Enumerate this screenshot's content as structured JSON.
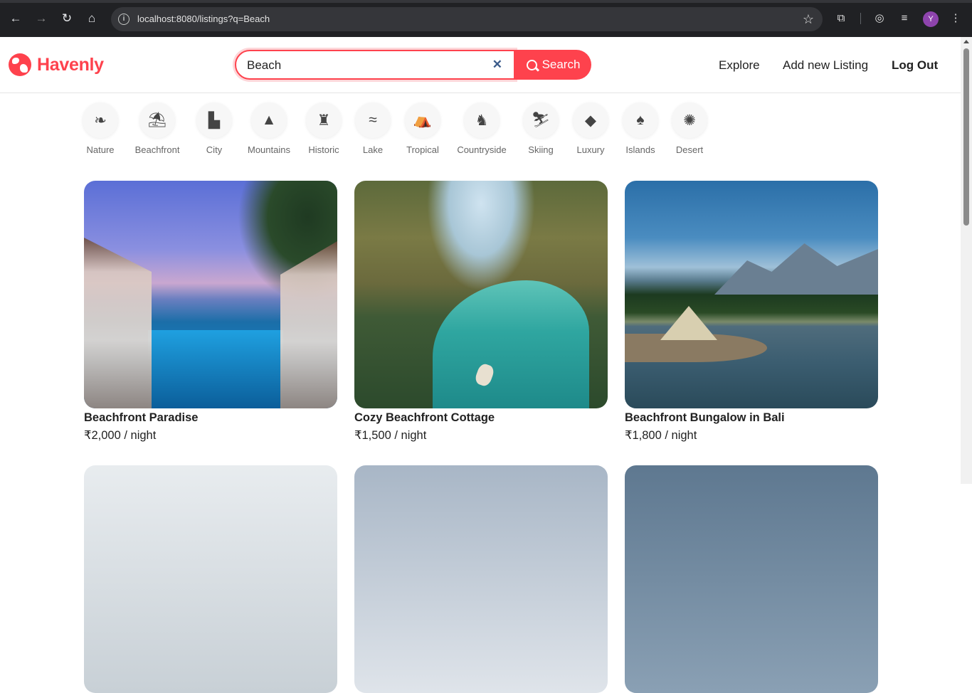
{
  "browser": {
    "url": "localhost:8080/listings?q=Beach",
    "profile_initial": "Y"
  },
  "navbar": {
    "brand": "Havenly",
    "search": {
      "value": "Beach",
      "button_label": "Search"
    },
    "links": {
      "explore": "Explore",
      "add_listing": "Add new Listing",
      "logout": "Log Out"
    }
  },
  "filters": [
    {
      "label": "Nature",
      "icon": "leaf-icon"
    },
    {
      "label": "Beachfront",
      "icon": "umbrella-beach-icon"
    },
    {
      "label": "City",
      "icon": "city-icon"
    },
    {
      "label": "Mountains",
      "icon": "mountain-icon"
    },
    {
      "label": "Historic",
      "icon": "castle-icon"
    },
    {
      "label": "Lake",
      "icon": "swimmer-icon"
    },
    {
      "label": "Tropical",
      "icon": "campground-icon"
    },
    {
      "label": "Countryside",
      "icon": "cow-icon"
    },
    {
      "label": "Skiing",
      "icon": "skier-icon"
    },
    {
      "label": "Luxury",
      "icon": "gem-icon"
    },
    {
      "label": "Islands",
      "icon": "tree-icon"
    },
    {
      "label": "Desert",
      "icon": "sun-icon"
    }
  ],
  "listings": [
    {
      "title": "Beachfront Paradise",
      "price": "₹2,000 / night"
    },
    {
      "title": "Cozy Beachfront Cottage",
      "price": "₹1,500 / night"
    },
    {
      "title": "Beachfront Bungalow in Bali",
      "price": "₹1,800 / night"
    }
  ],
  "colors": {
    "brand": "#fe424d",
    "text": "#222222",
    "muted": "#666666"
  }
}
